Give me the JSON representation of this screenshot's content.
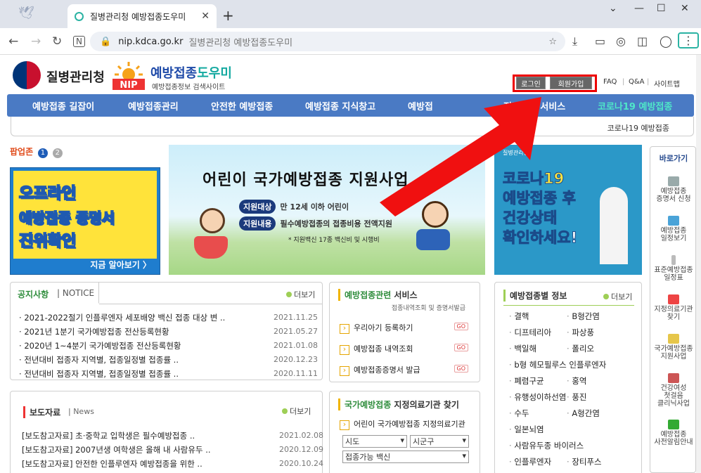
{
  "browser": {
    "tab_title": "질병관리청 예방접종도우미",
    "url_host": "nip.kdca.go.kr",
    "url_title": "질병관리청 예방접종도우미"
  },
  "header": {
    "kdca_name": "질병관리청",
    "nip_title_a": "예방접종",
    "nip_title_b": "도우미",
    "nip_sub": "예방접종정보 검색사이트",
    "login": "로그인",
    "join": "회원가입",
    "faq": "FAQ",
    "qna": "Q&A",
    "sitemap": "사이트맵"
  },
  "gnb": [
    "예방접종 길잡이",
    "예방접종관리",
    "안전한 예방접종",
    "예방접종 지식창고",
    "예방접",
    "전자민원 서비스",
    "코로나19 예방접종"
  ],
  "subbar": {
    "right": "코로나19 예방접종"
  },
  "popup": {
    "title": "팝업존",
    "n1": "1",
    "n2": "2",
    "l1": "오프라인",
    "l2": "예방접종 증명서",
    "l3": "진위확인",
    "more": "지금 알아보기 〉"
  },
  "main_banner": {
    "title": "어린이 국가예방접종 지원사업",
    "tag1": "지원대상",
    "text1": "만 12세 이하 어린이",
    "tag2": "지원내용",
    "text2": "필수예방접종의 접종비용 전액지원",
    "note": "* 지원백신 17종 백신비 및 시행비"
  },
  "covid_banner": {
    "logo": "질병관리청",
    "l1": "코로나19",
    "l2": "예방접종 후",
    "l3": "건강상태",
    "l4": "확인하세요!"
  },
  "quick": {
    "title": "바로가기",
    "items": [
      "예방접종\n증명서 신청",
      "예방접종\n일정보기",
      "표준예방접종\n일정표",
      "지정의료기관\n찾기",
      "국가예방접종\n지원사업",
      "건강여성\n첫걸음\n클리닉사업",
      "예방접종\n사전알림안내"
    ]
  },
  "notice": {
    "tab1": "공지사항",
    "tab2": "NOTICE",
    "more": "더보기",
    "rows": [
      {
        "t": "2021-2022절기 인플루엔자 세포배양 백신 접종 대상 변 ..",
        "d": "2021.11.25"
      },
      {
        "t": "2021년 1분기 국가예방접종 전산등록현황",
        "d": "2021.05.27"
      },
      {
        "t": "2020년 1~4분기 국가예방접종 전산등록현황",
        "d": "2021.01.08"
      },
      {
        "t": "전년대비 접종자 지역별, 접종일정별 접종률 ..",
        "d": "2020.12.23"
      },
      {
        "t": "전년대비 접종자 지역별, 접종일정별 접종률 ..",
        "d": "2020.11.11"
      }
    ]
  },
  "press": {
    "tab1": "보도자료",
    "tab2": "News",
    "more": "더보기",
    "rows": [
      {
        "t": "[보도참고자료] 초·중학교 입학생은 필수예방접종 ..",
        "d": "2021.02.08"
      },
      {
        "t": "[보도참고자료] 2007년생 여학생은 올해 내 사람유두 ..",
        "d": "2020.12.09"
      },
      {
        "t": "[보도참고자료] 안전한 인플루엔자 예방접종을 위한 ..",
        "d": "2020.10.24"
      }
    ]
  },
  "service": {
    "title_a": "예방접종관련",
    "title_b": " 서비스",
    "sub": "접종내역조회 및 증명서발급",
    "go": "GO",
    "rows": [
      "우리아기 등록하기",
      "예방접종 내역조회",
      "예방접종증명서 발급"
    ]
  },
  "clinic": {
    "title_a": "국가예방접종",
    "title_b": " 지정의료기관 찾기",
    "row": "어린이 국가예방접종 지정의료기관",
    "sel1": "시도",
    "sel2": "시군구",
    "sel3": "접종가능 백신"
  },
  "disease": {
    "title": "예방접종별 정보",
    "more": "더보기",
    "left": [
      "결핵",
      "디프테리아",
      "백일해",
      "b형 헤모필루스 인플루엔자",
      "폐렴구균",
      "유행성이하선염",
      "수두",
      "일본뇌염",
      "사람유두종 바이러스",
      "인플루엔자"
    ],
    "right": [
      "B형간염",
      "파상풍",
      "폴리오",
      "홍역",
      "풍진",
      "A형간염",
      "장티푸스"
    ]
  }
}
